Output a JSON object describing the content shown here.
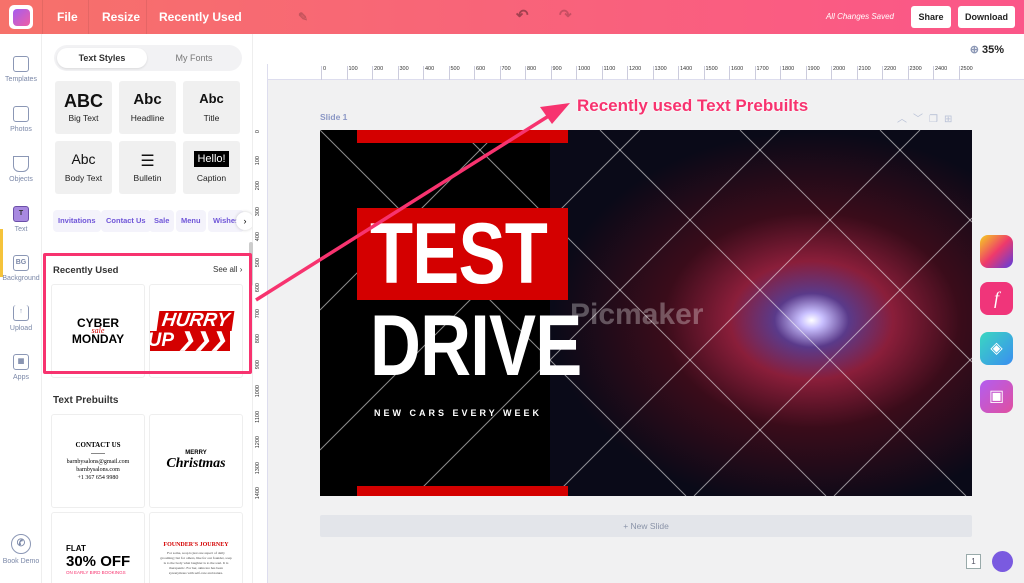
{
  "header": {
    "file": "File",
    "resize": "Resize",
    "title": "Recently Used",
    "saved": "All Changes Saved",
    "share": "Share",
    "download": "Download"
  },
  "rail": [
    {
      "label": "Templates"
    },
    {
      "label": "Photos"
    },
    {
      "label": "Objects"
    },
    {
      "label": "Text",
      "icon": "T"
    },
    {
      "label": "Background",
      "icon": "BG"
    },
    {
      "label": "Upload"
    },
    {
      "label": "Apps"
    },
    {
      "label": "Book Demo"
    }
  ],
  "panel": {
    "tabs": [
      "Text Styles",
      "My Fonts"
    ],
    "styles": [
      {
        "preview": "ABC",
        "label": "Big Text"
      },
      {
        "preview": "Abc",
        "label": "Headline"
      },
      {
        "preview": "Abc",
        "label": "Title"
      },
      {
        "preview": "Abc",
        "label": "Body Text"
      },
      {
        "preview": "☰",
        "label": "Bulletin"
      },
      {
        "preview": "Hello!",
        "label": "Caption"
      }
    ],
    "chips": [
      "Invitations",
      "Contact Us",
      "Sale",
      "Menu",
      "Wishes"
    ],
    "recent": {
      "title": "Recently Used",
      "see_all": "See all",
      "items": [
        {
          "line1": "CYBER",
          "script": "sale",
          "line2": "MONDAY"
        },
        {
          "line1": "HURRY",
          "line2": "UP"
        }
      ]
    },
    "prebuilts": {
      "title": "Text Prebuilts",
      "contact": {
        "title": "CONTACT US",
        "email": "barnbysalons@gmail.com",
        "site": "barnbysalons.com",
        "phone": "+1 367 654 9980"
      },
      "xmas": {
        "top": "MERRY",
        "script": "Christmas"
      },
      "flat": {
        "top": "FLAT",
        "big": "30% OFF",
        "sub": "ON EARLY BIRD BOOKINGS"
      },
      "founder": {
        "title": "FOUNDER'S JOURNEY",
        "body": "For some, soap is just one aspect of daily grooming; but for others, like for our founder, soap is to the body what laughter is to the soul. It is therapeutic. For her, skincare has been synonymous with self-care and nature."
      }
    }
  },
  "canvas": {
    "zoom": "35%",
    "slide_label": "Slide 1",
    "new_slide": "+ New Slide",
    "page_count": "1",
    "ruler_x": [
      "0",
      "100",
      "200",
      "300",
      "400",
      "500",
      "600",
      "700",
      "800",
      "900",
      "1000",
      "1100",
      "1200",
      "1300",
      "1400",
      "1500",
      "1600",
      "1700",
      "1800",
      "1900",
      "2000",
      "2100",
      "2200",
      "2300",
      "2400",
      "2500"
    ],
    "ruler_y": [
      "0",
      "100",
      "200",
      "300",
      "400",
      "500",
      "600",
      "700",
      "800",
      "900",
      "1000",
      "1100",
      "1200",
      "1300",
      "1400"
    ],
    "slide": {
      "line1": "TEST",
      "line2": "DRIVE",
      "tagline": "NEW CARS EVERY WEEK",
      "watermark": "Picmaker"
    }
  },
  "annotation": "Recently used Text Prebuilts",
  "colors": {
    "accent": "#f7336f",
    "brand_red": "#d40000"
  }
}
